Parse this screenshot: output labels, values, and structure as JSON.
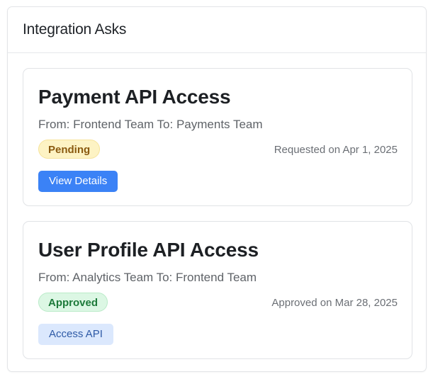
{
  "panel": {
    "title": "Integration Asks"
  },
  "cards": [
    {
      "title": "Payment API Access",
      "subtitle": "From: Frontend Team To: Payments Team",
      "status": "Pending",
      "date_text": "Requested on Apr 1, 2025",
      "action_label": "View Details"
    },
    {
      "title": "User Profile API Access",
      "subtitle": "From: Analytics Team To: Frontend Team",
      "status": "Approved",
      "date_text": "Approved on Mar 28, 2025",
      "action_label": "Access API"
    }
  ],
  "colors": {
    "primary": "#3b82f6",
    "pending_bg": "#fdf3c4",
    "pending_text": "#8a5a10",
    "approved_bg": "#dcf7e4",
    "approved_text": "#1d7a3a",
    "soft_button_bg": "#dbe8fd"
  }
}
